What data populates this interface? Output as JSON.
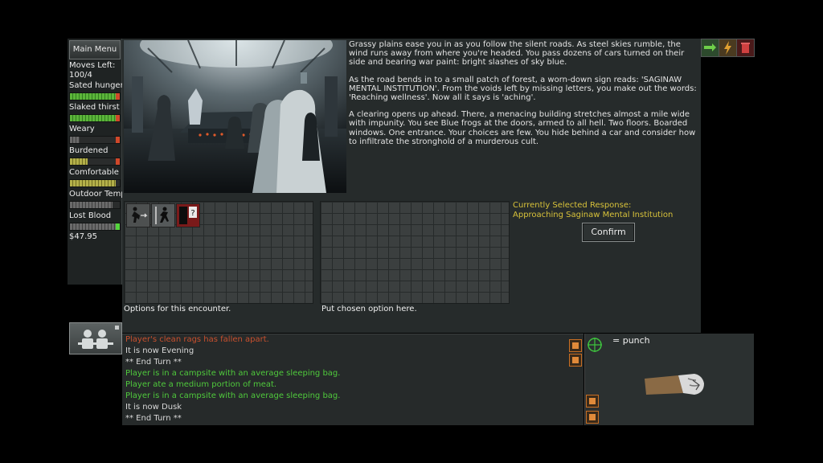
{
  "left_panel": {
    "main_menu_label": "Main Menu",
    "moves_label": "Moves Left:",
    "moves_value": "100/4",
    "stats": [
      {
        "label": "Sated hunger",
        "fill_percent": 92,
        "color": "green",
        "tip": "red"
      },
      {
        "label": "Slaked thirst",
        "fill_percent": 92,
        "color": "green",
        "tip": "red"
      },
      {
        "label": "Weary",
        "fill_percent": 20,
        "color": "gray",
        "tip": "red"
      },
      {
        "label": "Burdened",
        "fill_percent": 35,
        "color": "yellow",
        "tip": "red"
      },
      {
        "label": "Comfortable",
        "fill_percent": 92,
        "color": "yellow",
        "tip": "none"
      },
      {
        "label": "Outdoor Temperature",
        "fill_percent": 85,
        "color": "gray",
        "tip": "none"
      },
      {
        "label": "Lost Blood",
        "fill_percent": 92,
        "color": "gray",
        "tip": "green"
      }
    ],
    "money": "$47.95"
  },
  "story": {
    "p1": "Grassy plains ease you in as you follow the silent roads. As steel skies rumble, the wind runs away from where you're headed. You pass dozens of cars turned on their side and bearing war paint: bright slashes of sky blue.",
    "p2": "As the road bends in to a small patch of forest, a worn-down sign reads: 'SAGINAW MENTAL INSTITUTION'. From the voids left by missing letters, you make out the words: 'Reaching wellness'. Now all it says is 'aching'.",
    "p3": "A clearing opens up ahead. There, a menacing building stretches almost a mile wide with impunity. You see Blue frogs at the doors, armed to all hell. Two floors. Boarded windows. One entrance. Your choices are few. You hide behind a car and consider how to infiltrate the stronghold of a murderous cult."
  },
  "options_caption": "Options for this encounter.",
  "placement_caption": "Put chosen option here.",
  "selected_response": {
    "label": "Currently Selected Response:",
    "value": "Approaching Saginaw Mental Institution"
  },
  "confirm_label": "Confirm",
  "log": [
    {
      "text": "Player's clean rags has fallen apart.",
      "color": "#c9502e"
    },
    {
      "text": "It is now Evening",
      "color": "#d8d8d8"
    },
    {
      "text": "** End Turn **",
      "color": "#d8d8d8"
    },
    {
      "text": "Player is in a campsite with an average sleeping bag.",
      "color": "#4fc93c"
    },
    {
      "text": "Player ate a medium portion of meat.",
      "color": "#4fc93c"
    },
    {
      "text": "Player is in a campsite with an average sleeping bag.",
      "color": "#4fc93c"
    },
    {
      "text": "It is now Dusk",
      "color": "#d8d8d8"
    },
    {
      "text": "** End Turn **",
      "color": "#d8d8d8"
    }
  ],
  "equipped": {
    "label": "= punch"
  },
  "icons": {
    "top_right": [
      "exit-arrow-icon",
      "lightning-icon",
      "trash-icon"
    ],
    "options": [
      "run-away-icon",
      "sneak-icon",
      "mystery-door-icon"
    ],
    "equip": "crosshair-icon",
    "equip_item": "fist-icon"
  },
  "colors": {
    "accent_yellow": "#d8c23a",
    "log_green": "#4fc93c",
    "log_red": "#c9502e",
    "panel_bg": "#262b2b"
  }
}
